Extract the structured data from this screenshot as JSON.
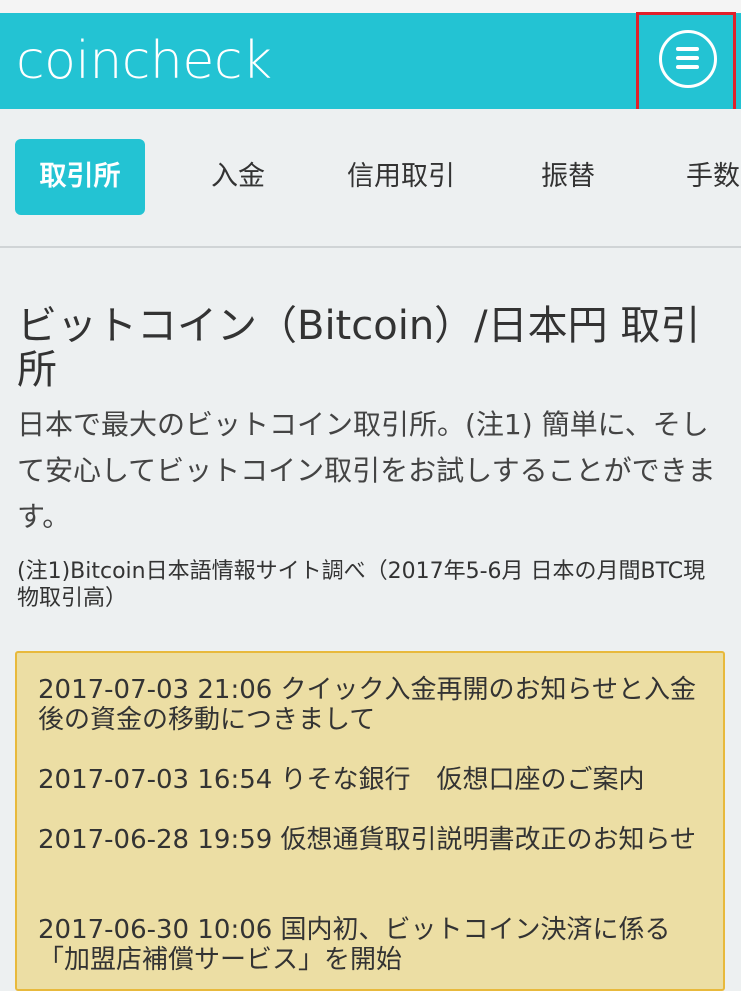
{
  "header": {
    "logo": "coincheck",
    "menu_icon": "hamburger-menu-icon"
  },
  "nav": {
    "items": [
      {
        "label": "取引所",
        "active": true
      },
      {
        "label": "入金"
      },
      {
        "label": "信用取引"
      },
      {
        "label": "振替"
      },
      {
        "label": "手数"
      }
    ]
  },
  "main": {
    "title": "ビットコイン（Bitcoin）/日本円 取引所",
    "description": "日本で最大のビットコイン取引所。(注1) 簡単に、そして安心してビットコイン取引をお試しすることができます。",
    "note": "(注1)Bitcoin日本語情報サイト調べ（2017年5-6月 日本の月間BTC現物取引高）"
  },
  "news": {
    "items": [
      {
        "text": "2017-07-03 21:06 クイック入金再開のお知らせと入金後の資金の移動につきまして"
      },
      {
        "text": "2017-07-03 16:54 りそな銀行　仮想口座のご案内"
      },
      {
        "text": "2017-06-28 19:59 仮想通貨取引説明書改正のお知らせ"
      },
      {
        "text": "2017-06-30 10:06 国内初、ビットコイン決済に係る「加盟店補償サービス」を開始"
      }
    ]
  },
  "colors": {
    "brand": "#23c3d3",
    "news_bg": "#ecdea4",
    "news_border": "#e8b93c",
    "highlight": "#e0202a"
  }
}
